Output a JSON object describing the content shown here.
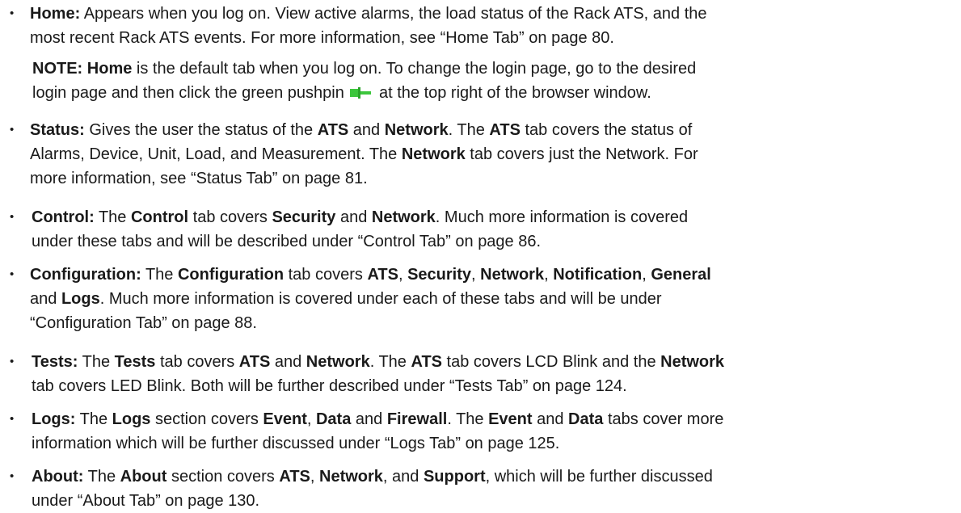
{
  "items": [
    {
      "line1": [
        "Home:",
        " Appears when you log on. View active alarms, the load status of the Rack ATS, and the"
      ],
      "line2": "most recent Rack ATS events. For more information, see “Home Tab” on page 80."
    }
  ],
  "note": {
    "label": "NOTE:",
    "bold_word": "Home",
    "text1": " is the default tab when you log on. To change the login page, go to the desired",
    "text2a": "login page and then click the green pushpin",
    "text2b": "at the top right of the browser window.",
    "pin_icon": "green-pushpin-icon",
    "pin_color": "#3cc63c"
  },
  "status": {
    "l1": [
      "Status:",
      " Gives the user the status of the ",
      "ATS",
      " and ",
      "Network",
      ". The ",
      "ATS",
      " tab covers the status of"
    ],
    "l2": [
      "Alarms, Device, Unit, Load, and Measurement. The ",
      "Network",
      " tab covers just the Network. For"
    ],
    "l3": "more information, see “Status Tab” on page 81."
  },
  "control": {
    "l1": [
      "Control:",
      " The ",
      "Control",
      " tab covers ",
      "Security",
      " and ",
      "Network",
      ". Much more information is covered"
    ],
    "l2": "under these tabs and will be described under “Control Tab” on page 86."
  },
  "configuration": {
    "l1": [
      "Configuration:",
      " The ",
      "Configuration",
      " tab covers ",
      "ATS",
      ", ",
      "Security",
      ", ",
      "Network",
      ", ",
      "Notification",
      ", ",
      "General"
    ],
    "l2": [
      "and ",
      "Logs",
      ". Much more information is covered under each of these tabs and will be under"
    ],
    "l3": "“Configuration Tab” on page 88."
  },
  "tests": {
    "l1": [
      "Tests:",
      " The ",
      "Tests",
      " tab covers ",
      "ATS",
      " and ",
      "Network",
      ". The ",
      "ATS",
      " tab covers LCD Blink and the ",
      "Network"
    ],
    "l2": "tab covers LED Blink. Both will be further described under “Tests Tab” on page 124."
  },
  "logs": {
    "l1": [
      "Logs:",
      " The ",
      "Logs",
      " section covers ",
      "Event",
      ", ",
      "Data",
      " and ",
      "Firewall",
      ". The ",
      "Event",
      " and ",
      "Data",
      " tabs cover more"
    ],
    "l2": "information which will be further discussed under “Logs Tab” on page 125."
  },
  "about": {
    "l1": [
      "About:",
      " The ",
      "About",
      " section covers ",
      "ATS",
      ", ",
      "Network",
      ", and ",
      "Support",
      ", which will be further discussed"
    ],
    "l2": "under “About Tab” on page 130."
  },
  "bullet_char": "•"
}
